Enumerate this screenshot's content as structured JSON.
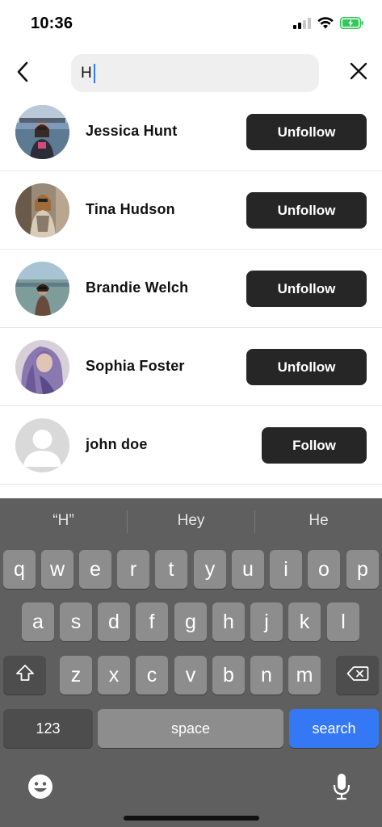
{
  "status_bar": {
    "time": "10:36"
  },
  "header": {
    "back_icon": "chevron-left-icon",
    "search_value": "H",
    "clear_icon": "close-icon"
  },
  "users": [
    {
      "name": "Jessica Hunt",
      "button": "Unfollow",
      "avatar_colors": [
        "#6f8fb0",
        "#2d2d3a",
        "#c98a7a"
      ]
    },
    {
      "name": "Tina Hudson",
      "button": "Unfollow",
      "avatar_colors": [
        "#a69482",
        "#4a3a30",
        "#d8c8b8"
      ]
    },
    {
      "name": "Brandie Welch",
      "button": "Unfollow",
      "avatar_colors": [
        "#9cb8c8",
        "#6e8a7e",
        "#c9a48a"
      ]
    },
    {
      "name": "Sophia Foster",
      "button": "Unfollow",
      "avatar_colors": [
        "#8a7aa8",
        "#6a5a90",
        "#d8bfb0"
      ]
    },
    {
      "name": "john doe",
      "button": "Follow",
      "avatar_colors": [
        "#d8d8d8",
        "#ffffff",
        "#ffffff"
      ]
    }
  ],
  "keyboard": {
    "suggestions": [
      "“H”",
      "Hey",
      "He"
    ],
    "row1": [
      "q",
      "w",
      "e",
      "r",
      "t",
      "y",
      "u",
      "i",
      "o",
      "p"
    ],
    "row2": [
      "a",
      "s",
      "d",
      "f",
      "g",
      "h",
      "j",
      "k",
      "l"
    ],
    "row3": [
      "z",
      "x",
      "c",
      "v",
      "b",
      "n",
      "m"
    ],
    "numbers_label": "123",
    "space_label": "space",
    "search_label": "search",
    "shift_icon": "shift-icon",
    "delete_icon": "backspace-icon",
    "emoji_icon": "emoji-icon",
    "mic_icon": "microphone-icon"
  },
  "colors": {
    "button_dark": "#262626",
    "search_key": "#3478f6",
    "keyboard_bg": "#5f5f5f",
    "key_bg": "#8d8d8d",
    "battery_green": "#34c759"
  }
}
